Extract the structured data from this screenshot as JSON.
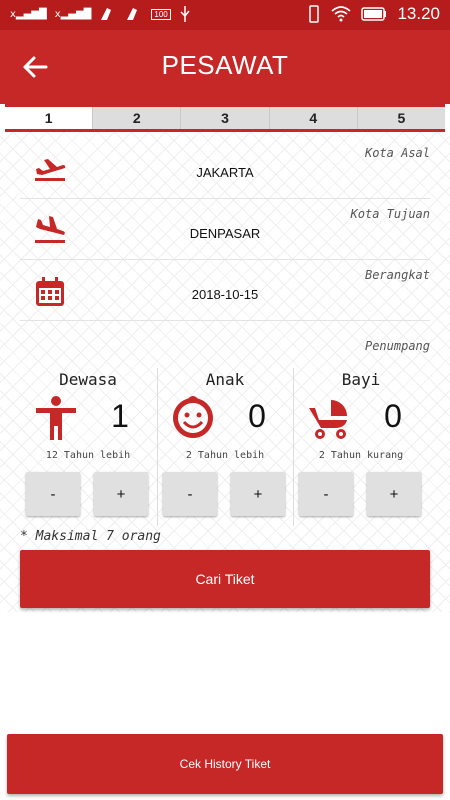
{
  "status_bar": {
    "time": "13.20",
    "signal_1": "x",
    "signal_2": "x",
    "battery_badge": "100"
  },
  "header": {
    "title": "PESAWAT"
  },
  "steps": [
    "1",
    "2",
    "3",
    "4",
    "5"
  ],
  "form": {
    "origin": {
      "label": "Kota Asal",
      "value": "JAKARTA",
      "icon": "plane-takeoff-icon"
    },
    "destination": {
      "label": "Kota Tujuan",
      "value": "DENPASAR",
      "icon": "plane-landing-icon"
    },
    "departure": {
      "label": "Berangkat",
      "value": "2018-10-15",
      "icon": "calendar-icon"
    }
  },
  "passengers": {
    "label": "Penumpang",
    "adult": {
      "title": "Dewasa",
      "count": "1",
      "sub": "12 Tahun lebih",
      "minus": "-",
      "plus": "+"
    },
    "child": {
      "title": "Anak",
      "count": "0",
      "sub": "2 Tahun lebih",
      "minus": "-",
      "plus": "+"
    },
    "infant": {
      "title": "Bayi",
      "count": "0",
      "sub": "2 Tahun kurang",
      "minus": "-",
      "plus": "+"
    },
    "note": "* Maksimal 7 orang"
  },
  "buttons": {
    "search": "Cari Tiket",
    "history": "Cek History Tiket"
  },
  "colors": {
    "primary": "#c62828",
    "status_bar": "#b71c1c",
    "icon_red": "#c62828"
  }
}
